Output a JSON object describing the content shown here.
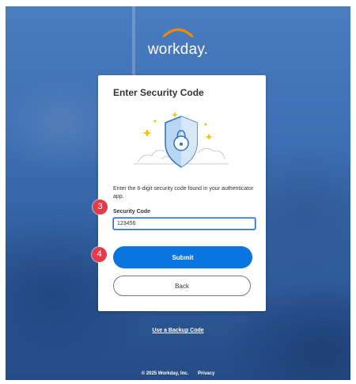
{
  "brand": {
    "name": "workday.",
    "arc_color": "#f38b00"
  },
  "card": {
    "title": "Enter Security Code",
    "instruction": "Enter the 6-digit security code found in your authenticator app.",
    "field_label": "Security Code",
    "field_value": "123456",
    "submit_label": "Submit",
    "back_label": "Back"
  },
  "annotations": {
    "step_a": "3",
    "step_b": "4"
  },
  "links": {
    "backup_code": "Use a Backup Code"
  },
  "footer": {
    "copyright": "© 2025 Workday, Inc.",
    "privacy": "Privacy"
  },
  "colors": {
    "primary": "#0875e1",
    "badge": "#e6394a",
    "shield": "#b9d6f2"
  },
  "icons": {
    "illustration": "shield-lock-icon"
  }
}
